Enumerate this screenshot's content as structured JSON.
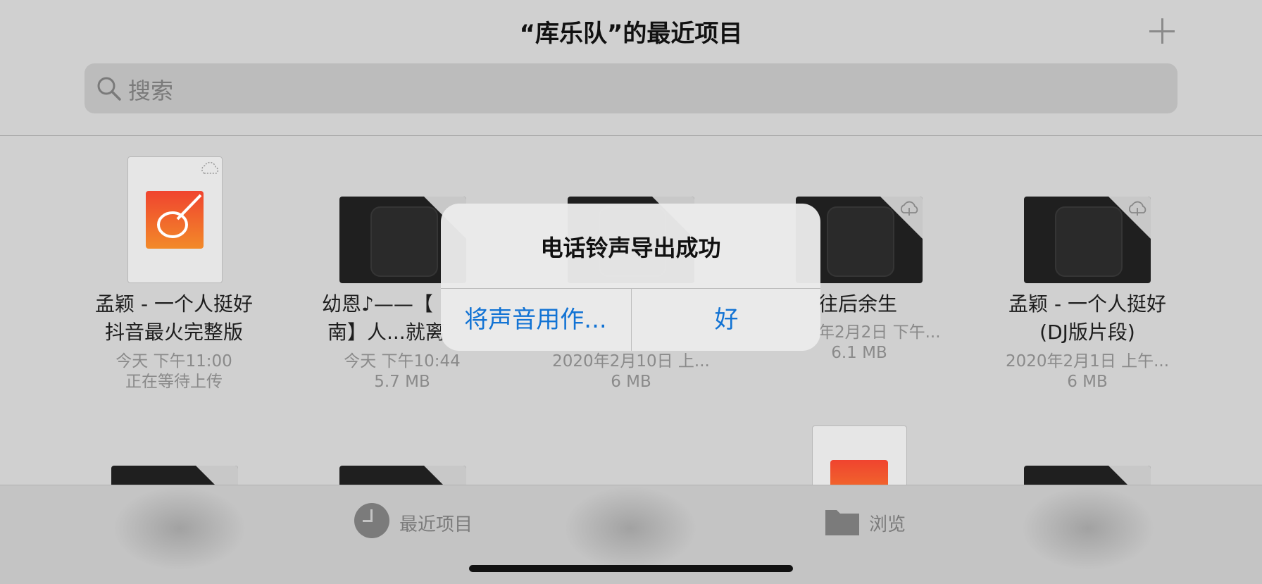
{
  "header": {
    "title": "“库乐队”的最近项目",
    "add_icon": "plus-icon"
  },
  "search": {
    "placeholder": "搜索",
    "icon": "search-icon"
  },
  "items": [
    {
      "name_line1": "孟颖 - 一个人挺好",
      "name_line2": "抖音最火完整版",
      "meta_line1": "今天 下午11:00",
      "meta_line2": "正在等待上传"
    },
    {
      "name_line1": "幼恩♪——【",
      "name_line2": "南】人...就离",
      "meta_line1": "今天 下午10:44",
      "meta_line2": "5.7 MB"
    },
    {
      "name_line1": "",
      "name_line2": "",
      "meta_line1": "2020年2月10日 上...",
      "meta_line2": "6 MB"
    },
    {
      "name_line1": "往后余生",
      "name_line2": "",
      "meta_line1": "年2月2日 下午...",
      "meta_line2": "6.1 MB"
    },
    {
      "name_line1": "孟颖 - 一个人挺好",
      "name_line2": "(DJ版片段)",
      "meta_line1": "2020年2月1日 上午...",
      "meta_line2": "6 MB"
    }
  ],
  "alert": {
    "title": "电话铃声导出成功",
    "button_use_as": "将声音用作...",
    "button_ok": "好"
  },
  "tabbar": {
    "recent_label": "最近项目",
    "browse_label": "浏览"
  },
  "colors": {
    "accent": "#1273d4",
    "garageband_top": "#f0442f",
    "garageband_bottom": "#f28a29"
  }
}
